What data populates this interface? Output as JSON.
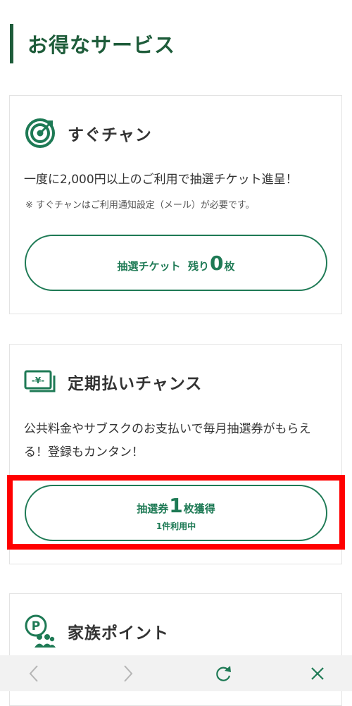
{
  "section": {
    "title": "お得なサービス"
  },
  "cards": [
    {
      "icon": "target-icon",
      "title": "すぐチャン",
      "description": "一度に2,000円以上のご利用で抽選チケット進呈！",
      "note": "※  すぐチャンはご利用通知設定（メール）が必要です。",
      "button": {
        "prefix": "抽選チケット  残り",
        "count": "0",
        "suffix": "枚"
      }
    },
    {
      "icon": "yen-bill-icon",
      "title": "定期払いチャンス",
      "description": "公共料金やサブスクのお支払いで毎月抽選券がもらえる！登録もカンタン！",
      "button": {
        "prefix": "抽選券",
        "count": "1",
        "suffix": "枚獲得",
        "sub": "1件利用中"
      }
    },
    {
      "icon": "family-points-icon",
      "title": "家族ポイント"
    }
  ],
  "browser_bar": {
    "back_icon": "chevron-left-icon",
    "forward_icon": "chevron-right-icon",
    "reload_icon": "reload-icon",
    "close_icon": "close-icon"
  },
  "colors": {
    "brand": "#1e5c3a",
    "accent": "#1e7a55",
    "highlight": "#ff0000"
  }
}
